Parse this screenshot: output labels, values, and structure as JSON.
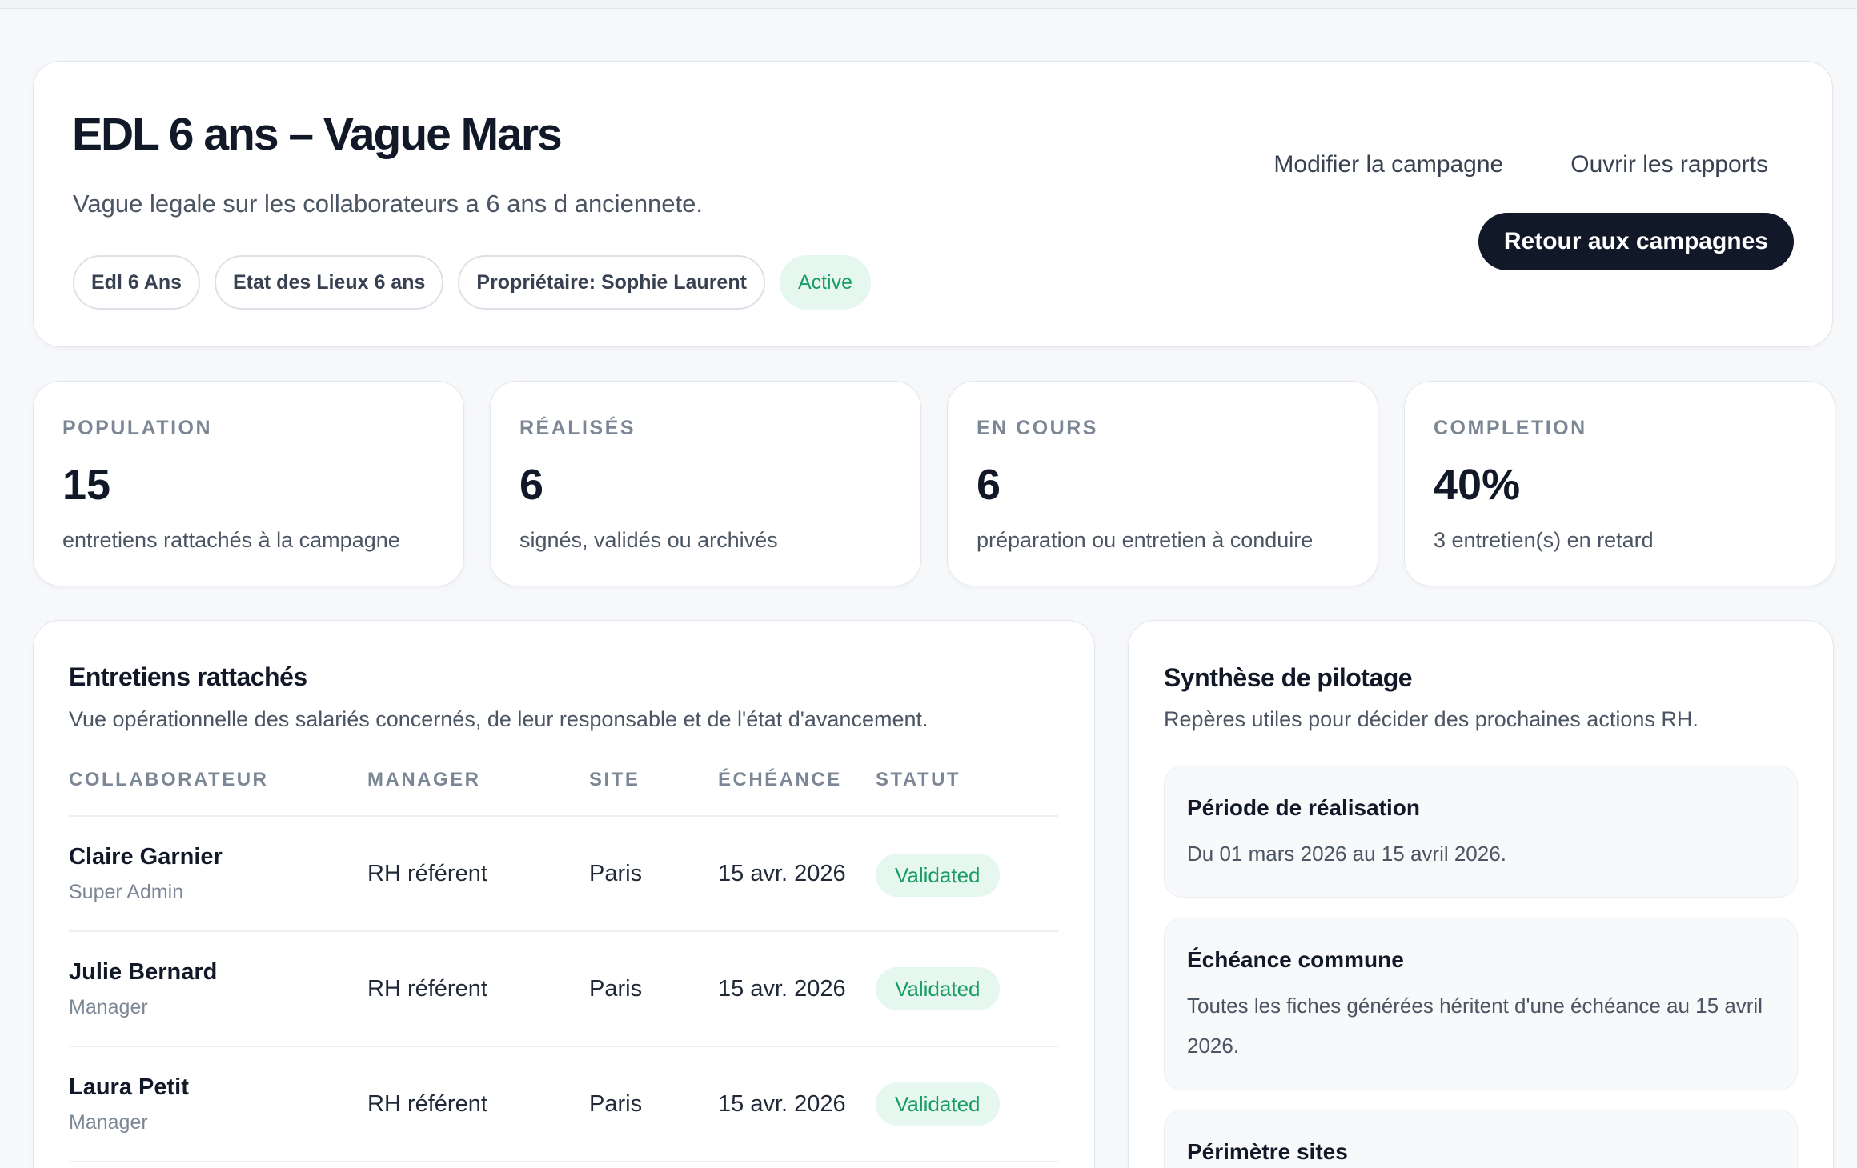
{
  "campaign": {
    "title": "EDL 6 ans – Vague Mars",
    "subtitle": "Vague legale sur les collaborateurs a 6 ans d anciennete.",
    "chips": [
      "Edl 6 Ans",
      "Etat des Lieux 6 ans",
      "Propriétaire: Sophie Laurent"
    ],
    "status": "Active",
    "actions": {
      "edit": "Modifier la campagne",
      "reports": "Ouvrir les rapports",
      "back": "Retour aux campagnes"
    }
  },
  "stats": [
    {
      "label": "POPULATION",
      "value": "15",
      "desc": "entretiens rattachés à la campagne"
    },
    {
      "label": "RÉALISÉS",
      "value": "6",
      "desc": "signés, validés ou archivés"
    },
    {
      "label": "EN COURS",
      "value": "6",
      "desc": "préparation ou entretien à conduire"
    },
    {
      "label": "COMPLETION",
      "value": "40%",
      "desc": "3 entretien(s) en retard"
    }
  ],
  "interviews": {
    "title": "Entretiens rattachés",
    "subtitle": "Vue opérationnelle des salariés concernés, de leur responsable et de l'état d'avancement.",
    "columns": [
      "COLLABORATEUR",
      "MANAGER",
      "SITE",
      "ÉCHÉANCE",
      "STATUT"
    ],
    "rows": [
      {
        "name": "Claire Garnier",
        "role": "Super Admin",
        "manager": "RH référent",
        "site": "Paris",
        "due": "15 avr. 2026",
        "status": "Validated"
      },
      {
        "name": "Julie Bernard",
        "role": "Manager",
        "manager": "RH référent",
        "site": "Paris",
        "due": "15 avr. 2026",
        "status": "Validated"
      },
      {
        "name": "Laura Petit",
        "role": "Manager",
        "manager": "RH référent",
        "site": "Paris",
        "due": "15 avr. 2026",
        "status": "Validated"
      }
    ]
  },
  "summary": {
    "title": "Synthèse de pilotage",
    "subtitle": "Repères utiles pour décider des prochaines actions RH.",
    "items": [
      {
        "title": "Période de réalisation",
        "text": "Du 01 mars 2026 au 15 avril 2026."
      },
      {
        "title": "Échéance commune",
        "text": "Toutes les fiches générées héritent d'une échéance au 15 avril 2026."
      },
      {
        "title": "Périmètre sites",
        "text": ""
      }
    ]
  },
  "colors": {
    "primary": "#111827",
    "success_bg": "#e6f7ef",
    "success_text": "#1a9d62",
    "muted": "#7c8796"
  }
}
